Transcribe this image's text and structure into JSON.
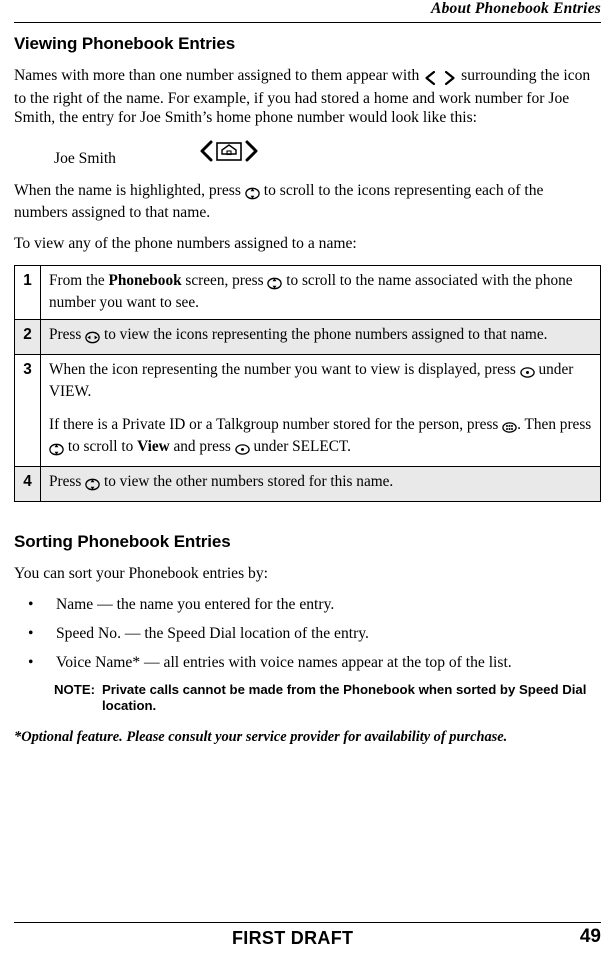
{
  "header": {
    "title": "About Phonebook Entries"
  },
  "sections": {
    "viewing": {
      "heading": "Viewing Phonebook Entries",
      "intro_1": "Names with more than one number assigned to them appear with",
      "intro_2": "surrounding the icon to the right of the name. For example, if you had stored a home and work number for Joe Smith, the entry for Joe Smith’s home phone number would look like this:",
      "example_name": "Joe Smith",
      "after_1": "When the name is highlighted, press",
      "after_2": "to scroll to the icons representing each of the numbers assigned to that name.",
      "lead_in": "To view any of the phone numbers assigned to a name:"
    },
    "steps": [
      {
        "num": "1",
        "parts": [
          "From the ",
          "Phonebook",
          " screen, press ",
          "[nav-up-down]",
          " to scroll to the name associated with the phone number you want to see."
        ],
        "text": "From the Phonebook screen, press to scroll to the name associated with the phone number you want to see.",
        "shaded": false
      },
      {
        "num": "2",
        "text": "Press to view the icons representing the phone numbers assigned to that name.",
        "shaded": true
      },
      {
        "num": "3",
        "text": "When the icon representing the number you want to view is displayed, press under VIEW.",
        "text2": "If there is a Private ID or a Talkgroup number stored for the person, press . Then press to scroll to View and press under SELECT.",
        "shaded": false
      },
      {
        "num": "4",
        "text": "Press to view the other numbers stored for this name.",
        "shaded": true
      }
    ],
    "sorting": {
      "heading": "Sorting Phonebook Entries",
      "intro": "You can sort your Phonebook entries by:",
      "bullets": [
        "Name — the name you entered for the entry.",
        "Speed No. — the Speed Dial location of the entry.",
        "Voice Name* — all entries with voice names appear at the top of the list."
      ],
      "note_label": "NOTE:",
      "note_text": "Private calls cannot be made from the Phonebook when sorted by Speed Dial location.",
      "footnote": "*Optional feature. Please consult your service provider for availability of purchase."
    }
  },
  "step_text": {
    "s1_a": "From the ",
    "s1_bold": "Phonebook",
    "s1_b": " screen, press ",
    "s1_c": " to scroll to the name associated with the phone number you want to see.",
    "s2_a": "Press ",
    "s2_b": " to view the icons representing the phone numbers assigned to that name.",
    "s3_a": "When the icon representing the number you want to view is displayed, press ",
    "s3_b": " under VIEW.",
    "s3_c": "If there is a Private ID or a Talkgroup number stored for the person, press ",
    "s3_d": ". Then press ",
    "s3_e": " to scroll to ",
    "s3_bold": "View",
    "s3_f": " and press ",
    "s3_g": " under SELECT.",
    "s4_a": "Press ",
    "s4_b": " to view the other numbers stored for this name."
  },
  "icons": {
    "left_arrow": "‹",
    "right_arrow": "›",
    "bullet": "•",
    "nav_left_right": "nav-left-right-key",
    "nav_up_down": "nav-up-down-key",
    "menu_key": "menu-key",
    "select_key": "select-key",
    "home_icon": "home-icon"
  },
  "footer": {
    "left": "FIRST DRAFT",
    "page": "49"
  }
}
